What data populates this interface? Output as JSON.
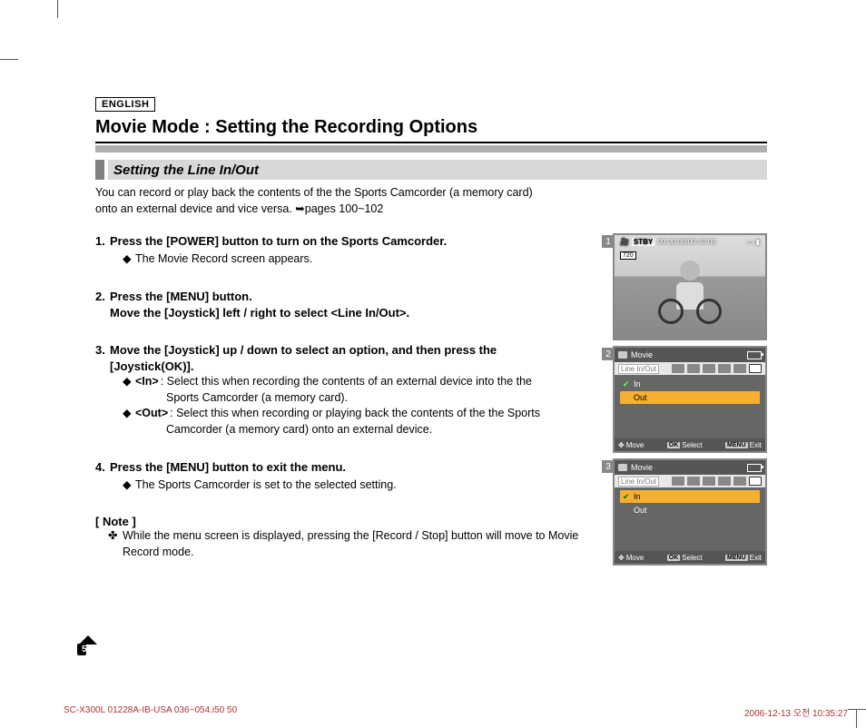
{
  "lang_label": "ENGLISH",
  "title": "Movie Mode : Setting the Recording Options",
  "subhead": "Setting the Line In/Out",
  "intro_line1": "You can record or play back the contents of the the Sports Camcorder (a memory card)",
  "intro_line2": "onto an external device and vice versa. ",
  "intro_ref": "➥pages 100~102",
  "steps": {
    "s1": {
      "head": "Press the [POWER] button to turn on the Sports Camcorder.",
      "sub1": "The Movie Record screen appears."
    },
    "s2": {
      "head_l1": "Press the [MENU] button.",
      "head_l2": "Move the [Joystick] left / right to select <Line In/Out>."
    },
    "s3": {
      "head_l1": "Move the [Joystick] up / down to select an option, and then press the",
      "head_l2": "[Joystick(OK)].",
      "opt_in_label": "<In>",
      "opt_in_text": ": Select this when recording the contents of an external device into the the",
      "opt_in_cont": "Sports Camcorder (a memory card).",
      "opt_out_label": "<Out>",
      "opt_out_text": ": Select this when recording or playing back the contents of the the Sports",
      "opt_out_cont": "Camcorder (a memory card) onto an external device."
    },
    "s4": {
      "head": "Press the [MENU] button to exit the menu.",
      "sub1": "The Sports Camcorder is set to the selected setting."
    }
  },
  "note_head": "[ Note ]",
  "note_body": "While the menu screen is displayed, pressing the [Record / Stop] button will move to Movie Record mode.",
  "page_num": "50",
  "fig": {
    "f1": {
      "num": "1",
      "stby": "STBY",
      "time": "00:00:00/00:40:05",
      "res": "720"
    },
    "f2": {
      "num": "2",
      "mode": "Movie",
      "menu_title": "Line In/Out",
      "row_in": "In",
      "row_out": "Out",
      "foot_move": "Move",
      "foot_ok": "OK",
      "foot_select": "Select",
      "foot_menu": "MENU",
      "foot_exit": "Exit"
    },
    "f3": {
      "num": "3",
      "mode": "Movie",
      "menu_title": "Line In/Out",
      "row_in": "In",
      "row_out": "Out",
      "foot_move": "Move",
      "foot_ok": "OK",
      "foot_select": "Select",
      "foot_menu": "MENU",
      "foot_exit": "Exit"
    }
  },
  "footer_left": "SC-X300L 01228A-IB-USA 036~054.i50   50",
  "footer_right": "2006-12-13   오전 10:35:27"
}
